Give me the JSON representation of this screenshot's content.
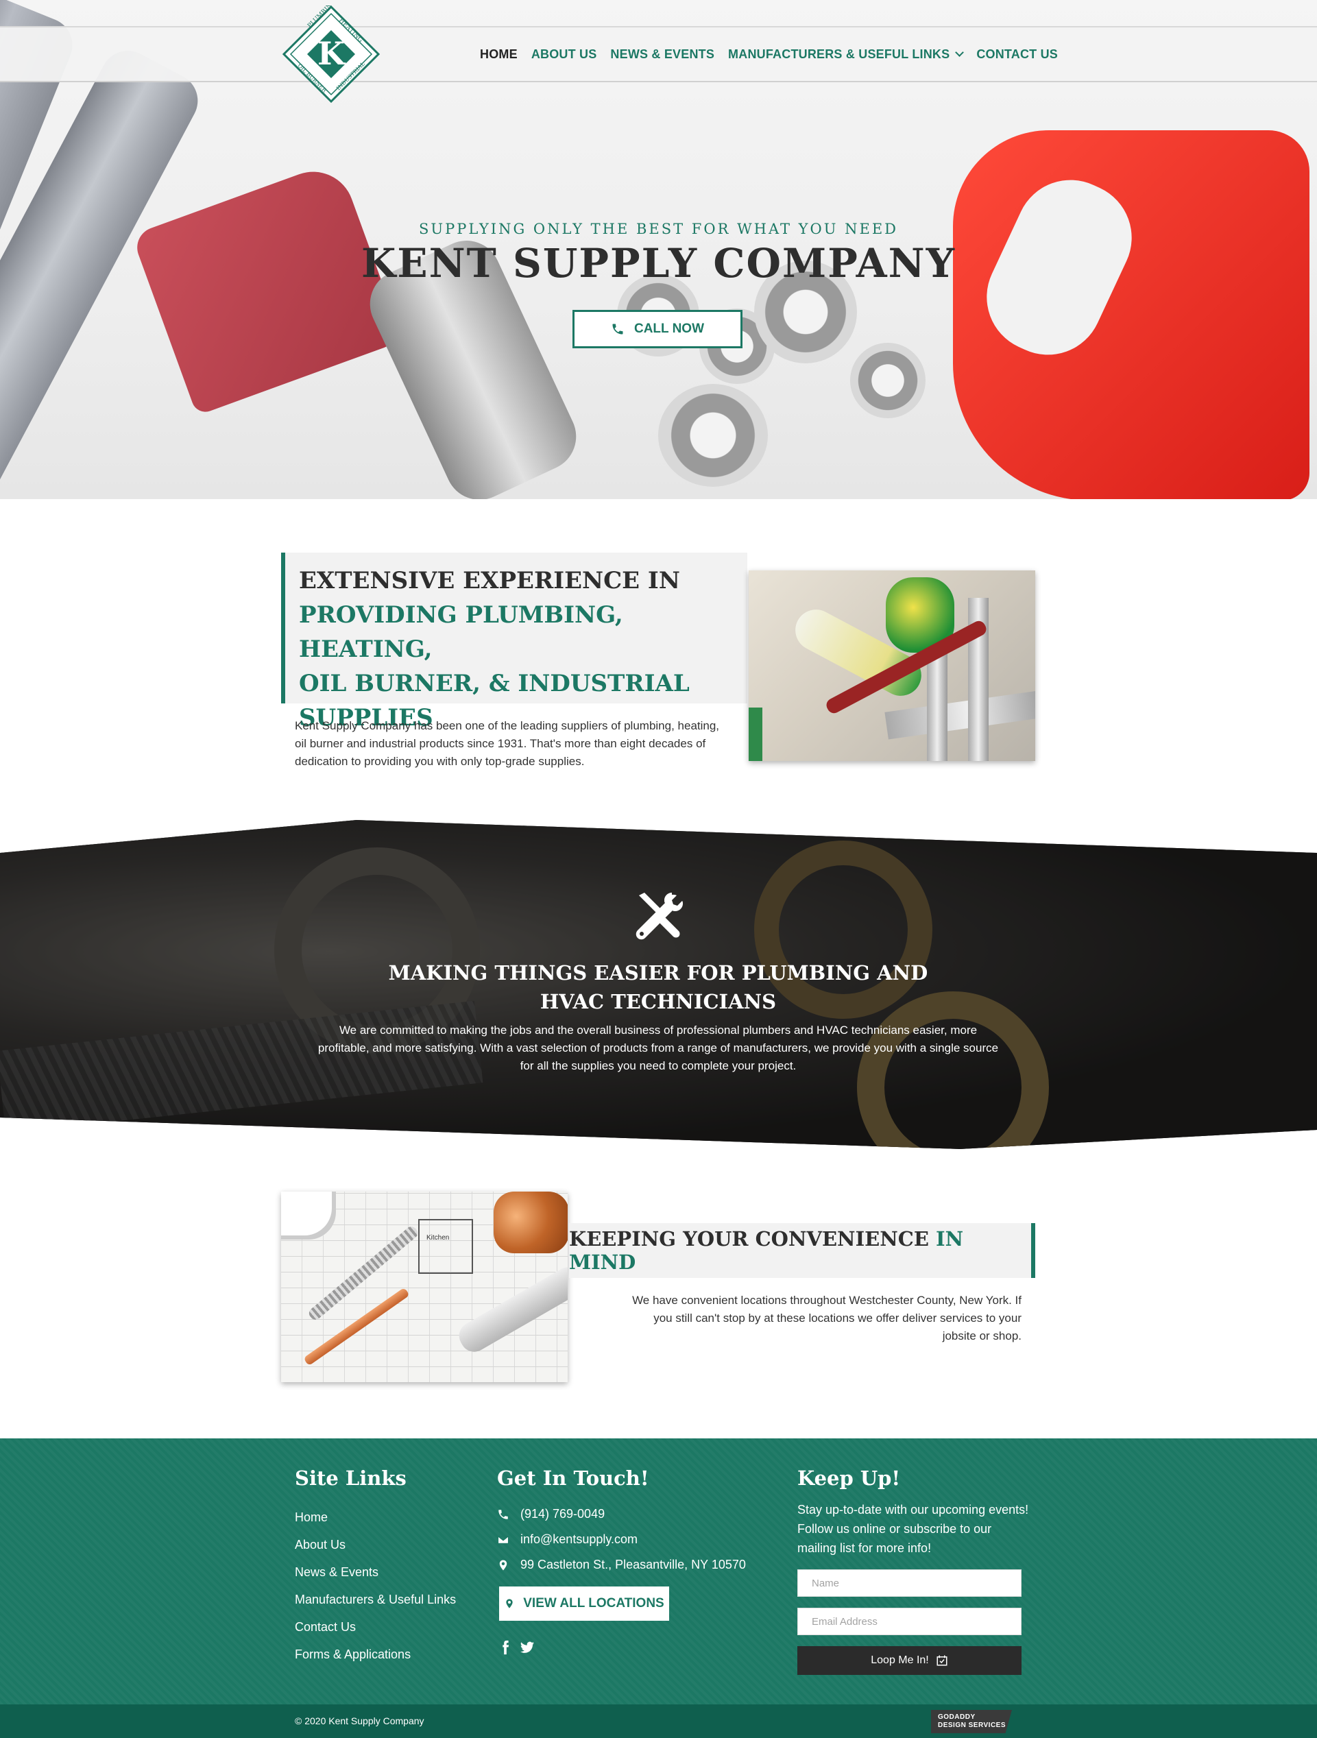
{
  "brand": {
    "logo_text_top": "PLUMBING",
    "logo_text_right": "HEATING",
    "logo_text_bottom": "INDUSTRIAL",
    "logo_text_left": "OIL BURNER",
    "logo_letter": "K",
    "accent_color": "#1c7864",
    "dark_color": "#2e2e2e"
  },
  "nav": {
    "items": [
      {
        "label": "HOME",
        "active": true
      },
      {
        "label": "ABOUT US"
      },
      {
        "label": "NEWS & EVENTS"
      },
      {
        "label": "MANUFACTURERS & USEFUL LINKS",
        "has_dropdown": true,
        "icon": "chevron-down-icon"
      },
      {
        "label": "CONTACT US"
      }
    ]
  },
  "hero": {
    "tagline": "SUPPLYING ONLY THE BEST FOR WHAT YOU NEED",
    "title": "KENT SUPPLY COMPANY",
    "cta_label": "CALL NOW",
    "cta_icon": "phone-icon"
  },
  "experience": {
    "heading_line1": "EXTENSIVE EXPERIENCE IN",
    "heading_line2": "PROVIDING PLUMBING, HEATING,",
    "heading_line3": "OIL BURNER, & INDUSTRIAL",
    "heading_line4": "SUPPLIES",
    "body": "Kent Supply Company has been one of the leading suppliers of plumbing, heating, oil burner and industrial products since 1931. That's more than eight decades of dedication to providing you with only top-grade supplies."
  },
  "technicians": {
    "icon": "tools-icon",
    "heading_line1": "MAKING THINGS EASIER FOR PLUMBING AND",
    "heading_line2": "HVAC TECHNICIANS",
    "body": "We are committed to making the jobs and the overall business of professional plumbers and HVAC technicians easier, more profitable, and more satisfying. With a vast selection of products from a range of manufacturers, we provide you with a single source for all the supplies you need to complete your project."
  },
  "convenience": {
    "heading_dark": "KEEPING YOUR CONVENIENCE",
    "heading_green": "IN MIND",
    "body": "We have convenient locations throughout Westchester County, New York. If you still can't stop by at these locations we offer deliver services to your jobsite or shop.",
    "image_label": "Kitchen"
  },
  "footer": {
    "site_links_title": "Site Links",
    "site_links": [
      "Home",
      "About Us",
      "News & Events",
      "Manufacturers & Useful Links",
      "Contact Us",
      "Forms & Applications"
    ],
    "contact_title": "Get In Touch!",
    "phone": "(914) 769-0049",
    "email": "info@kentsupply.com",
    "address": "99 Castleton St., Pleasantville, NY 10570",
    "locations_button": "VIEW ALL LOCATIONS",
    "social_icons": [
      "facebook-icon",
      "twitter-icon"
    ],
    "keep_up_title": "Keep Up!",
    "keep_up_text": "Stay up-to-date with our upcoming events! Follow us online or subscribe to our mailing list for more info!",
    "name_placeholder": "Name",
    "email_placeholder": "Email Address",
    "subscribe_label": "Loop Me In!",
    "copyright": "© 2020 Kent Supply Company",
    "badge_line1": "GODADDY",
    "badge_line2": "DESIGN SERVICES"
  }
}
